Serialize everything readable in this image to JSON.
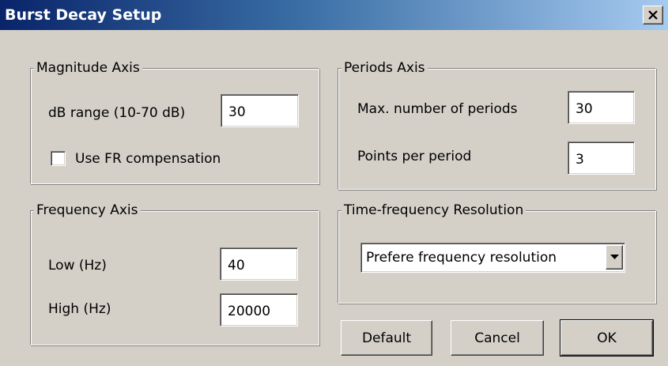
{
  "window": {
    "title": "Burst Decay Setup",
    "close_glyph": "✕"
  },
  "magnitude_axis": {
    "label": "Magnitude Axis",
    "db_range_label": "dB range (10-70 dB)",
    "db_range_value": "30",
    "fr_compensation_label": "Use FR compensation",
    "fr_compensation_checked": false
  },
  "periods_axis": {
    "label": "Periods Axis",
    "max_periods_label": "Max. number of periods",
    "max_periods_value": "30",
    "points_per_period_label": "Points per period",
    "points_per_period_value": "3"
  },
  "frequency_axis": {
    "label": "Frequency Axis",
    "low_label": "Low (Hz)",
    "low_value": "40",
    "high_label": "High (Hz)",
    "high_value": "20000"
  },
  "time_frequency_resolution": {
    "label": "Time-frequency Resolution",
    "selected": "Prefere frequency resolution"
  },
  "buttons": {
    "default_label": "Default",
    "cancel_label": "Cancel",
    "ok_label": "OK"
  },
  "icons": {
    "close": "close-icon",
    "dropdown": "chevron-down-icon"
  },
  "colors": {
    "titlebar_start": "#0a246a",
    "titlebar_end": "#a6caf0",
    "face": "#d4d0c8"
  }
}
